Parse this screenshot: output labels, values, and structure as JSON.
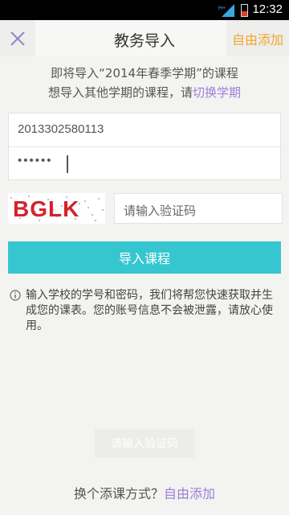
{
  "status_bar": {
    "time": "12:32",
    "network_label": "H+",
    "icons": [
      "signal-icon",
      "battery-icon"
    ]
  },
  "title_bar": {
    "title": "教务导入",
    "action_label": "自由添加",
    "close_icon": "close-icon",
    "accent_color": "#f0a72b"
  },
  "notice": {
    "line1": "即将导入“2014年春季学期”的课程",
    "line2_prefix": "想导入其他学期的课程，请",
    "line2_link": "切换学期",
    "link_color": "#9b7fd9"
  },
  "form": {
    "student_id_value": "2013302580113",
    "password_value": "••••••",
    "captcha_image_text": "BGLK",
    "captcha_placeholder": "请输入验证码"
  },
  "import_button": {
    "label": "导入课程",
    "color": "#36c6cf"
  },
  "info": {
    "icon": "info-icon",
    "text": "输入学校的学号和密码，我们将帮您快速获取并生成您的课表。您的账号信息不会被泄露，请放心使用。"
  },
  "toast": {
    "text": "请输入验证码"
  },
  "footer": {
    "prefix": "换个添课方式？",
    "link": "自由添加"
  }
}
